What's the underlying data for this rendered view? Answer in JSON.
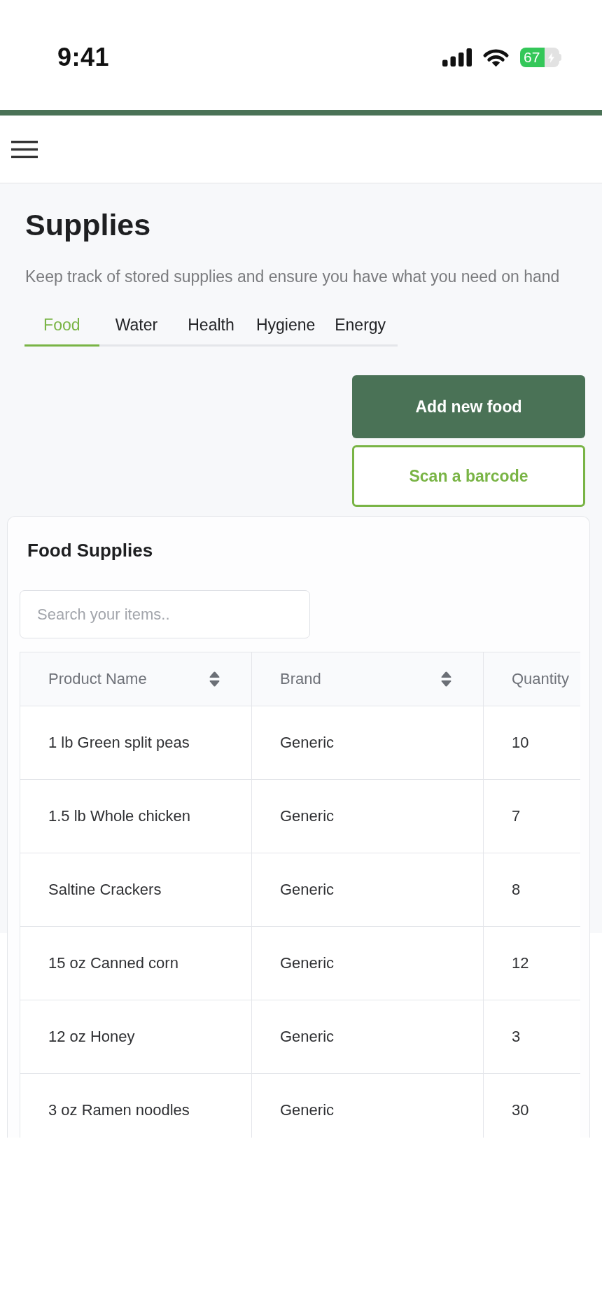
{
  "status_bar": {
    "time": "9:41",
    "battery": "67"
  },
  "page": {
    "title": "Supplies",
    "subtitle": "Keep track of stored supplies and ensure you have what you need on hand",
    "tabs": [
      {
        "label": "Food",
        "selected": true
      },
      {
        "label": "Water",
        "selected": false
      },
      {
        "label": "Health",
        "selected": false
      },
      {
        "label": "Hygiene",
        "selected": false
      },
      {
        "label": "Energy",
        "selected": false
      }
    ]
  },
  "actions": [
    {
      "label": "Add new food",
      "kind": "primary"
    },
    {
      "label": "Scan a barcode",
      "kind": "outline"
    }
  ],
  "card": {
    "title": "Food Supplies",
    "search": {
      "placeholder": "Search your items.."
    },
    "table": {
      "columns": [
        {
          "label": "Product Name",
          "sortable": true
        },
        {
          "label": "Brand",
          "sortable": true
        },
        {
          "label": "Quantity",
          "sortable": false
        }
      ],
      "rows": [
        [
          "1 lb Green split peas",
          "Generic",
          "10"
        ],
        [
          "1.5 lb Whole chicken",
          "Generic",
          "7"
        ],
        [
          "Saltine Crackers",
          "Generic",
          "8"
        ],
        [
          "15 oz Canned corn",
          "Generic",
          "12"
        ],
        [
          "12 oz Honey",
          "Generic",
          "3"
        ],
        [
          "3 oz Ramen noodles",
          "Generic",
          "30"
        ]
      ]
    }
  }
}
